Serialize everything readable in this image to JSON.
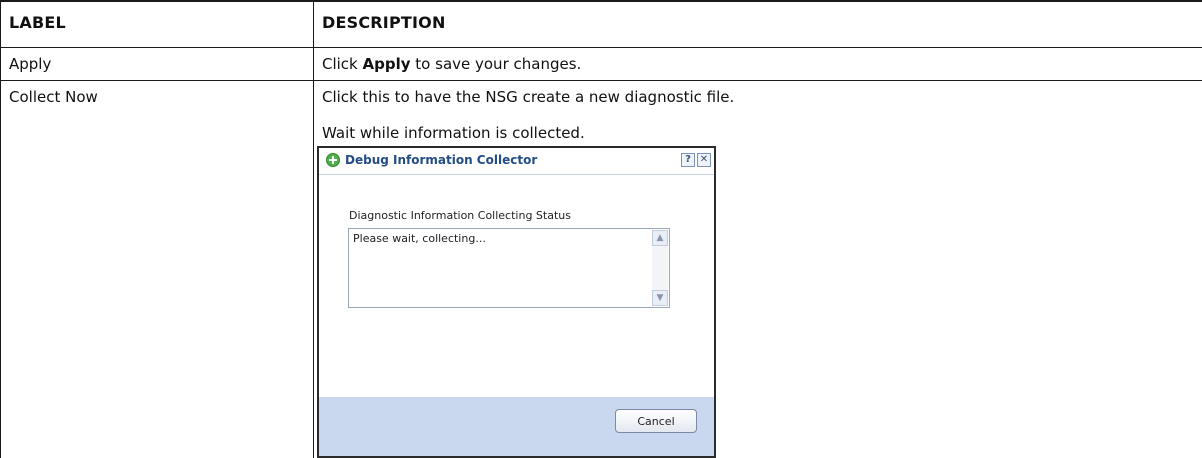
{
  "table": {
    "headers": {
      "label": "LABEL",
      "description": "DESCRIPTION"
    },
    "rows": [
      {
        "label": "Apply",
        "desc_prefix": "Click ",
        "desc_bold": "Apply",
        "desc_suffix": " to save your changes."
      },
      {
        "label": "Collect Now",
        "desc_line1": "Click this to have the NSG create a new diagnostic file.",
        "desc_line2": "Wait while information is collected."
      }
    ]
  },
  "dialog": {
    "title": "Debug Information Collector",
    "status_label": "Diagnostic Information Collecting Status",
    "status_text": "Please wait, collecting...",
    "cancel_label": "Cancel",
    "help_glyph": "?",
    "close_glyph": "✕"
  }
}
